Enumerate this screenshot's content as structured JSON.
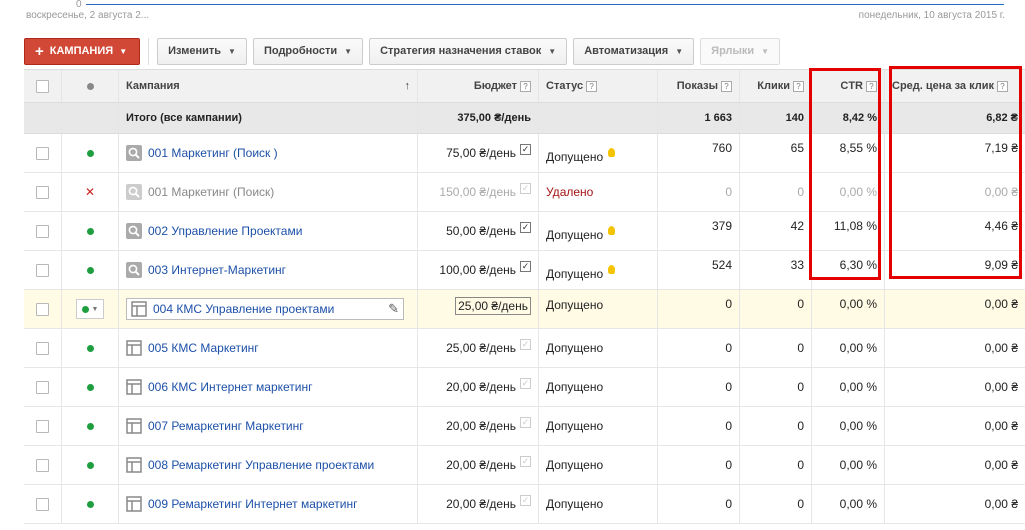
{
  "chart": {
    "zero_label": "0",
    "start_date": "воскресенье, 2 августа 2...",
    "end_date": "понедельник, 10 августа 2015 г."
  },
  "toolbar": {
    "campaign_btn": "КАМПАНИЯ",
    "edit_btn": "Изменить",
    "details_btn": "Подробности",
    "bidding_btn": "Стратегия назначения ставок",
    "automation_btn": "Автоматизация",
    "labels_btn": "Ярлыки"
  },
  "columns": {
    "campaign": "Кампания",
    "budget": "Бюджет",
    "status": "Статус",
    "impressions": "Показы",
    "clicks": "Клики",
    "ctr": "CTR",
    "avg_cpc": "Сред. цена за клик",
    "help": "?"
  },
  "total": {
    "label": "Итого (все кампании)",
    "budget": "375,00 ₴/день",
    "impressions": "1 663",
    "clicks": "140",
    "ctr": "8,42 %",
    "avg_cpc": "6,82 ₴"
  },
  "rows": [
    {
      "name": "001 Маркетинг (Поиск )",
      "budget": "75,00 ₴/день",
      "status": "Допущено",
      "impressions": "760",
      "clicks": "65",
      "ctr": "8,55 %",
      "avg_cpc": "7,19 ₴"
    },
    {
      "name": "001 Маркетинг (Поиск)",
      "budget": "150,00 ₴/день",
      "status": "Удалено",
      "impressions": "0",
      "clicks": "0",
      "ctr": "0,00 %",
      "avg_cpc": "0,00 ₴"
    },
    {
      "name": "002 Управление Проектами",
      "budget": "50,00 ₴/день",
      "status": "Допущено",
      "impressions": "379",
      "clicks": "42",
      "ctr": "11,08 %",
      "avg_cpc": "4,46 ₴"
    },
    {
      "name": "003 Интернет-Маркетинг",
      "budget": "100,00 ₴/день",
      "status": "Допущено",
      "impressions": "524",
      "clicks": "33",
      "ctr": "6,30 %",
      "avg_cpc": "9,09 ₴"
    },
    {
      "name": "004 КМС Управление проектами",
      "budget": "25,00 ₴/день",
      "status": "Допущено",
      "impressions": "0",
      "clicks": "0",
      "ctr": "0,00 %",
      "avg_cpc": "0,00 ₴"
    },
    {
      "name": "005 КМС Маркетинг",
      "budget": "25,00 ₴/день",
      "status": "Допущено",
      "impressions": "0",
      "clicks": "0",
      "ctr": "0,00 %",
      "avg_cpc": "0,00 ₴"
    },
    {
      "name": "006 КМС Интернет маркетинг",
      "budget": "20,00 ₴/день",
      "status": "Допущено",
      "impressions": "0",
      "clicks": "0",
      "ctr": "0,00 %",
      "avg_cpc": "0,00 ₴"
    },
    {
      "name": "007 Ремаркетинг Маркетинг",
      "budget": "20,00 ₴/день",
      "status": "Допущено",
      "impressions": "0",
      "clicks": "0",
      "ctr": "0,00 %",
      "avg_cpc": "0,00 ₴"
    },
    {
      "name": "008 Ремаркетинг Управление проектами",
      "budget": "20,00 ₴/день",
      "status": "Допущено",
      "impressions": "0",
      "clicks": "0",
      "ctr": "0,00 %",
      "avg_cpc": "0,00 ₴"
    },
    {
      "name": "009 Ремаркетинг Интернет маркетинг",
      "budget": "20,00 ₴/день",
      "status": "Допущено",
      "impressions": "0",
      "clicks": "0",
      "ctr": "0,00 %",
      "avg_cpc": "0,00 ₴"
    }
  ],
  "colors": {
    "accent_red": "#d14836",
    "link_blue": "#1d50a8",
    "status_green": "#1e9e3e",
    "highlight_frame": "#e50000"
  }
}
